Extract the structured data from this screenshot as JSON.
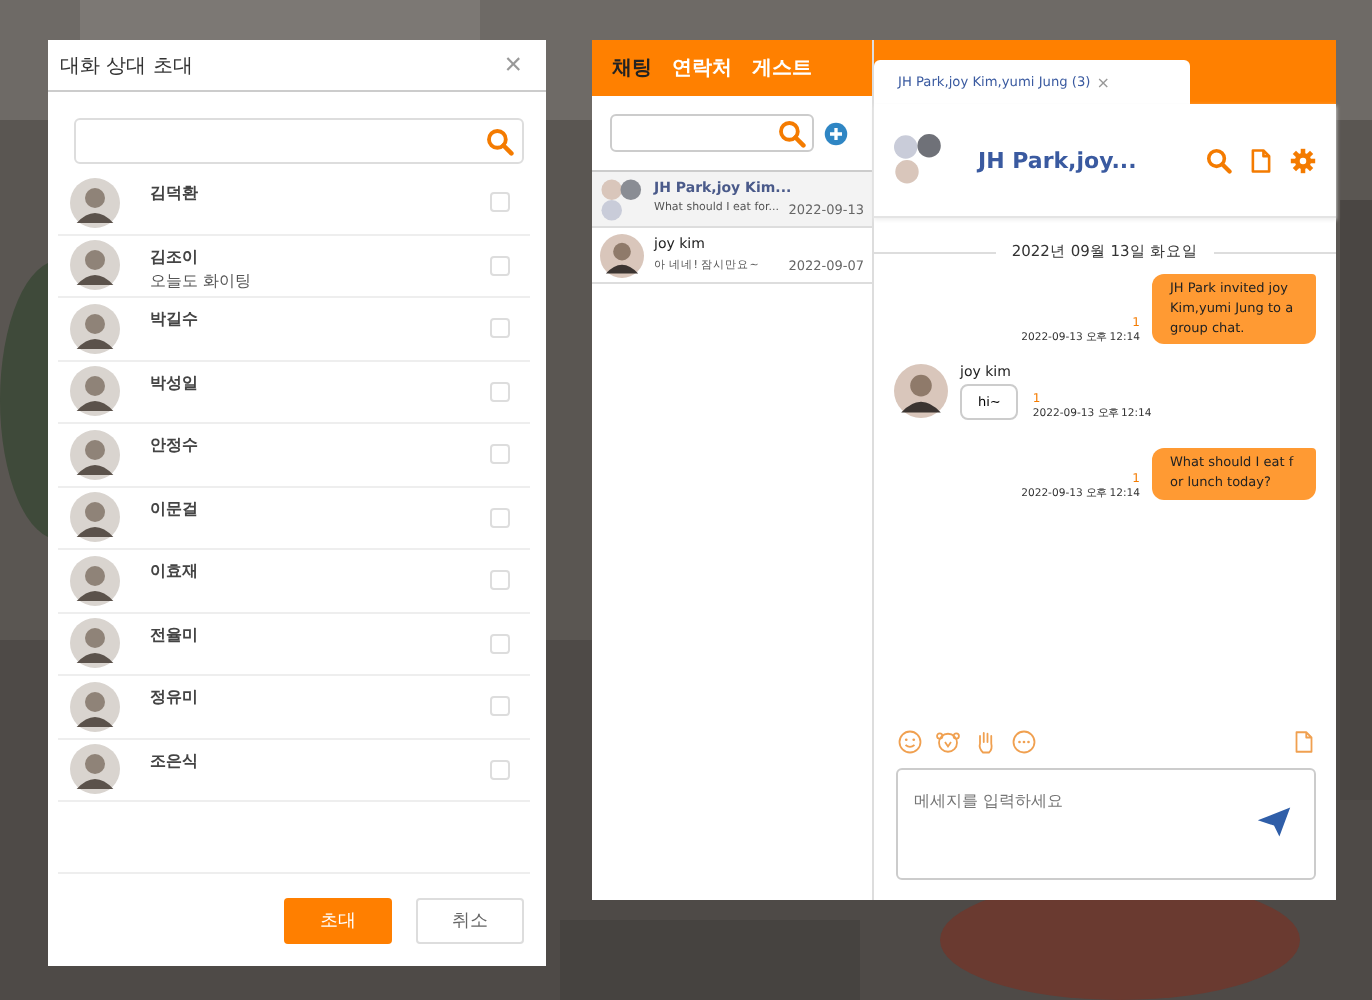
{
  "invite_dialog": {
    "title": "대화 상대 초대",
    "close": "×",
    "people": [
      {
        "name": "김덕환",
        "checked": false
      },
      {
        "name": "김조이",
        "status": "오늘도 화이팅",
        "checked": false
      },
      {
        "name": "박길수",
        "checked": false
      },
      {
        "name": "박성일",
        "checked": false
      },
      {
        "name": "안정수",
        "checked": false
      },
      {
        "name": "이문걸",
        "checked": false
      },
      {
        "name": "이효재",
        "checked": false
      },
      {
        "name": "전율미",
        "checked": false
      },
      {
        "name": "정유미",
        "checked": false
      },
      {
        "name": "조은식",
        "checked": false
      }
    ],
    "buttons": [
      {
        "label": "초대",
        "kind": "primary"
      },
      {
        "label": "취소",
        "kind": "secondary"
      }
    ]
  },
  "messenger": {
    "tabs": [
      {
        "label": "채팅",
        "selected": true
      },
      {
        "label": "연락처",
        "selected": false
      },
      {
        "label": "게스트",
        "selected": false
      }
    ],
    "chats": [
      {
        "name": "JH Park,joy Kim...",
        "preview": "What should I eat for...",
        "date": "2022-09-13",
        "group": true,
        "selected": true
      },
      {
        "name": "joy kim",
        "preview": "아 네네! 잠시만요~",
        "date": "2022-09-07",
        "group": false,
        "selected": false
      }
    ],
    "room_tab": {
      "label": "JH Park,joy Kim,yumi Jung (3)",
      "close": "×"
    },
    "room_title": "JH Park,joy...",
    "date_divider": "2022년 09월 13일 화요일",
    "messages": [
      {
        "kind": "mine",
        "text": "JH Park invited joy Kim,yumi Jung to a group chat.",
        "unread": "1",
        "time": "2022-09-13 오후 12:14"
      },
      {
        "kind": "theirs",
        "sender": "joy kim",
        "text": "hi~",
        "unread": "1",
        "time": "2022-09-13 오후 12:14"
      },
      {
        "kind": "mine",
        "text": "What should I eat f or lunch today?",
        "unread": "1",
        "time": "2022-09-13 오후 12:14"
      }
    ],
    "composer": {
      "placeholder": "메세지를 입력하세요"
    }
  }
}
